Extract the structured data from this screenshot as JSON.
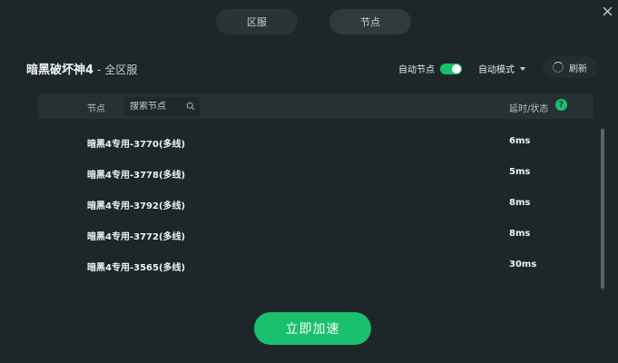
{
  "tabs": [
    {
      "label": "区服"
    },
    {
      "label": "节点"
    }
  ],
  "game": {
    "name": "暗黑破坏神4",
    "separator": "-",
    "region": "全区服"
  },
  "controls": {
    "auto_node_label": "自动节点",
    "auto_node_on": true,
    "auto_mode_label": "自动模式",
    "refresh_label": "刷新"
  },
  "list_header": {
    "node_label": "节点",
    "search_placeholder": "搜索节点",
    "latency_label": "延时/状态",
    "help_glyph": "?"
  },
  "nodes": [
    {
      "name": "暗黑4专用-3770(多线)",
      "latency": "6ms"
    },
    {
      "name": "暗黑4专用-3778(多线)",
      "latency": "5ms"
    },
    {
      "name": "暗黑4专用-3792(多线)",
      "latency": "8ms"
    },
    {
      "name": "暗黑4专用-3772(多线)",
      "latency": "8ms"
    },
    {
      "name": "暗黑4专用-3565(多线)",
      "latency": "30ms"
    }
  ],
  "boost_button": {
    "label": "立即加速"
  },
  "colors": {
    "background": "#1d2729",
    "accent": "#19c06e",
    "panel": "#263134"
  },
  "icons": [
    "close-icon",
    "toggle-switch",
    "caret-down-icon",
    "spinner-icon",
    "search-icon",
    "help-icon"
  ]
}
